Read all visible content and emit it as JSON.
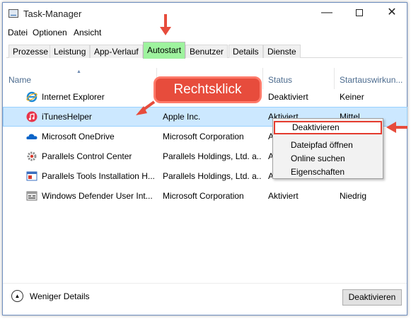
{
  "window": {
    "title": "Task-Manager",
    "controls": {
      "minimize": "—",
      "close": "✕"
    }
  },
  "menu": [
    "Datei",
    "Optionen",
    "Ansicht"
  ],
  "tabs": [
    "Prozesse",
    "Leistung",
    "App-Verlauf",
    "Autostart",
    "Benutzer",
    "Details",
    "Dienste"
  ],
  "active_tab": "Autostart",
  "columns": {
    "name": "Name",
    "publisher": "",
    "status": "Status",
    "impact": "Startauswirkun..."
  },
  "rows": [
    {
      "name": "Internet Explorer",
      "publisher": "",
      "status": "Deaktiviert",
      "impact": "Keiner",
      "icon": "internet-explorer-icon"
    },
    {
      "name": "iTunesHelper",
      "publisher": "Apple Inc.",
      "status": "Aktiviert",
      "impact": "Mittel",
      "icon": "itunes-icon"
    },
    {
      "name": "Microsoft OneDrive",
      "publisher": "Microsoft Corporation",
      "status": "A",
      "impact": "",
      "icon": "onedrive-icon"
    },
    {
      "name": "Parallels Control Center",
      "publisher": "Parallels Holdings, Ltd. a...",
      "status": "A",
      "impact": "",
      "icon": "parallels-gear-icon"
    },
    {
      "name": "Parallels Tools Installation H...",
      "publisher": "Parallels Holdings, Ltd. a...",
      "status": "A",
      "impact": "",
      "icon": "parallels-window-icon"
    },
    {
      "name": "Windows Defender User Int...",
      "publisher": "Microsoft Corporation",
      "status": "Aktiviert",
      "impact": "Niedrig",
      "icon": "defender-icon"
    }
  ],
  "context_menu": [
    "Deaktivieren",
    "Dateipfad öffnen",
    "Online suchen",
    "Eigenschaften"
  ],
  "annotation": "Rechtsklick",
  "footer": {
    "fewer_details": "Weniger Details",
    "disable_button": "Deaktivieren"
  },
  "colors": {
    "accent_red": "#e74c3c",
    "active_tab_green": "#9ef39e",
    "selection_blue": "#cce8ff"
  }
}
